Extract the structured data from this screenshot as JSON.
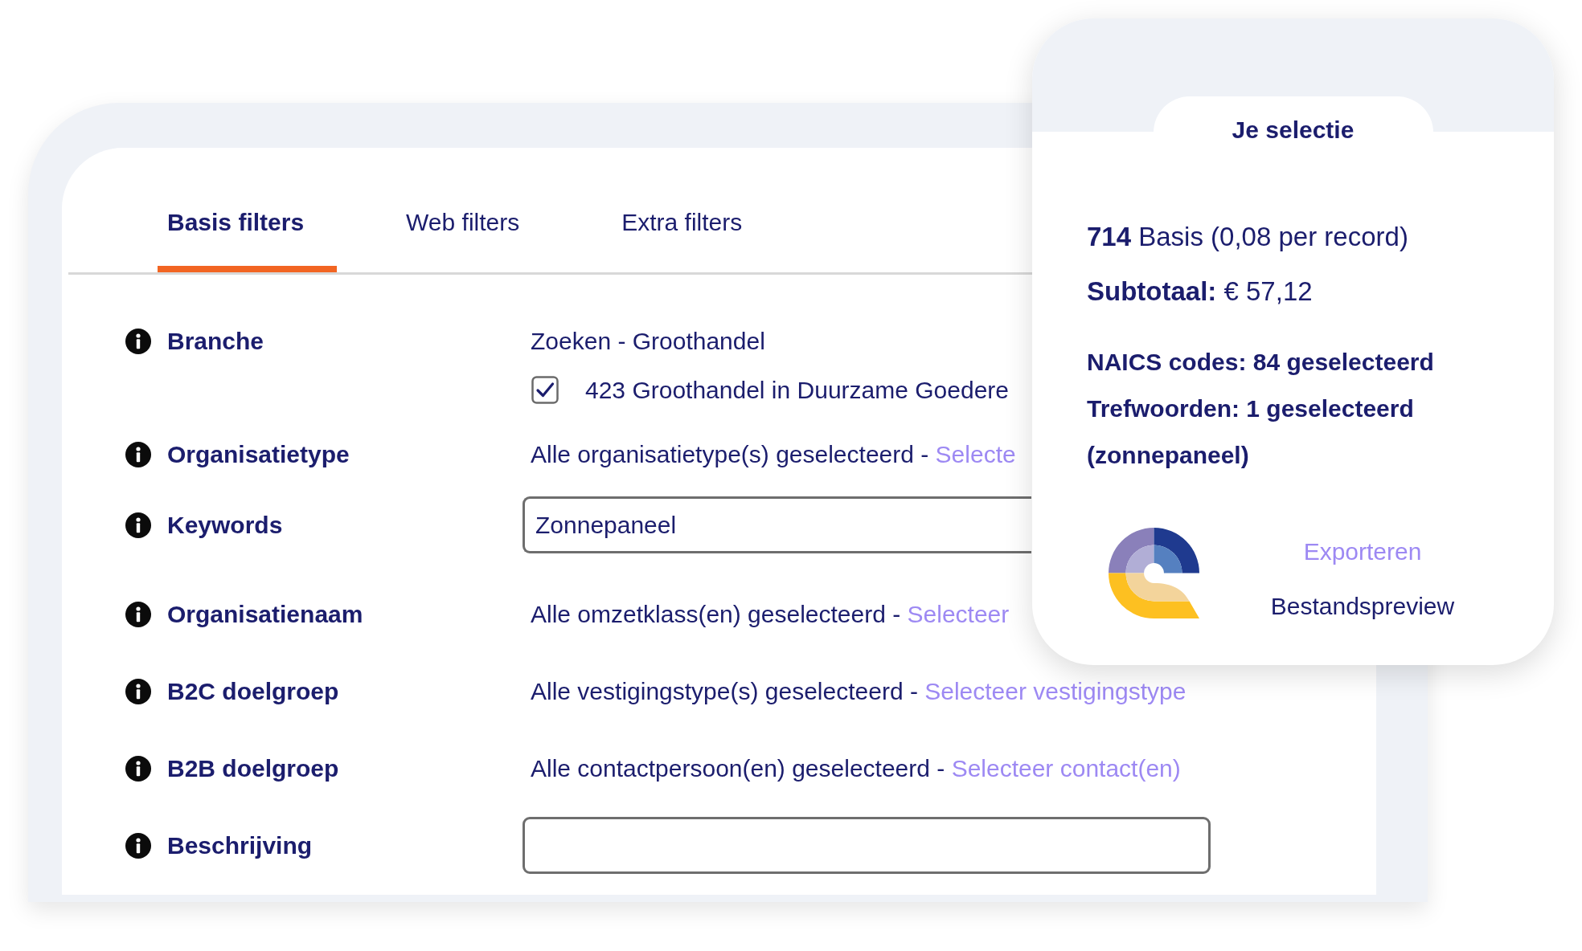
{
  "filter_panel": {
    "tabs": [
      {
        "label": "Basis filters",
        "selected": true
      },
      {
        "label": "Web filters",
        "selected": false
      },
      {
        "label": "Extra filters",
        "selected": false
      }
    ],
    "rows": [
      {
        "kind": "checklist",
        "label": "Branche",
        "value": "Zoeken - Groothandel",
        "options": [
          {
            "label": "423 Groothandel in Duurzame Goedere",
            "checked": true
          }
        ]
      },
      {
        "kind": "text",
        "label": "Organisatietype",
        "value": "Alle organisatietype(s) geselecteerd -",
        "link": "Selecte"
      },
      {
        "kind": "tags",
        "label": "Keywords",
        "value": "Zonnepaneel"
      },
      {
        "kind": "text",
        "label": "Organisatienaam",
        "value": "Alle omzetklass(en) geselecteerd -",
        "link": "Selecteer"
      },
      {
        "kind": "text",
        "label": "B2C doelgroep",
        "value": "Alle vestigingstype(s) geselecteerd -",
        "link": "Selecteer vestigingstype"
      },
      {
        "kind": "text",
        "label": "B2B doelgroep",
        "value": "Alle contactpersoon(en) geselecteerd -",
        "link": "Selecteer contact(en)"
      },
      {
        "kind": "input",
        "label": "Beschrijving"
      }
    ]
  },
  "selection_card": {
    "title": "Je selectie",
    "price_line": "**714** Basis (0,08 per record)",
    "subtotal": "**Subtotaal:** € 57,12",
    "summary": [
      "NAICS codes: 84 geselecteerd",
      "Trefwoorden: 1 geselecteerd",
      "(zonnepaneel)"
    ],
    "actions": [
      {
        "kind": "link",
        "label": "Exporteren"
      },
      {
        "kind": "plain",
        "label": "Bestandspreview"
      }
    ]
  }
}
